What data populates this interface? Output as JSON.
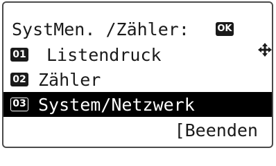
{
  "header": {
    "title": "SystMen. /Zähler:",
    "nav_icon": "four-way-arrows-icon",
    "ok_label": "OK"
  },
  "menu": {
    "items": [
      {
        "number": "01",
        "label": "Listendruck",
        "selected": false
      },
      {
        "number": "02",
        "label": "Zähler",
        "selected": false
      },
      {
        "number": "03",
        "label": "System/Netzwerk",
        "selected": true
      }
    ]
  },
  "footer": {
    "exit_label": "[Beenden"
  },
  "colors": {
    "highlight_bg": "#000000",
    "highlight_fg": "#ffffff",
    "text": "#1a1a1a",
    "frame": "#4a4a4a"
  }
}
